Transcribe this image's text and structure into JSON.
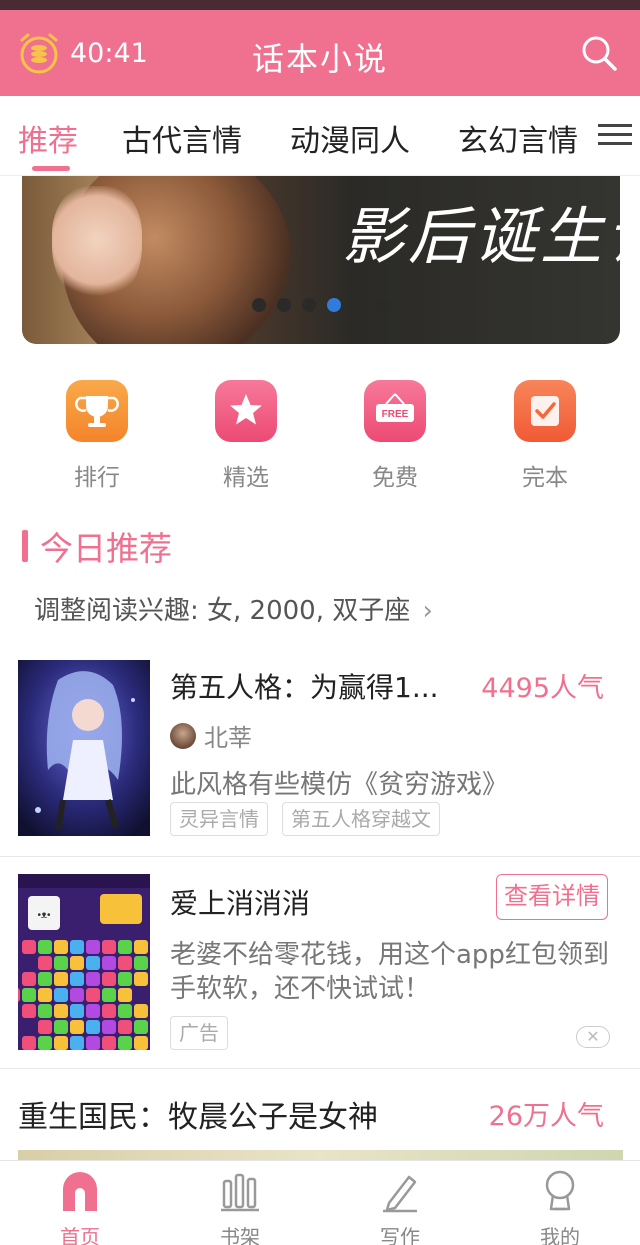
{
  "topbar": {
    "timer": "40:41",
    "title": "话本小说",
    "timer_icon": "alarm-clock-coins-icon",
    "search_icon": "search-icon"
  },
  "tabs": [
    {
      "label": "推荐",
      "active": true
    },
    {
      "label": "古代言情",
      "active": false
    },
    {
      "label": "动漫同人",
      "active": false
    },
    {
      "label": "玄幻言情",
      "active": false
    }
  ],
  "banner": {
    "title": "影后诞生记",
    "slide_count": 6,
    "active_slide": 4
  },
  "quick_links": [
    {
      "label": "排行",
      "icon": "trophy-icon",
      "color": "#f7952f"
    },
    {
      "label": "精选",
      "icon": "star-icon",
      "color": "#f0587e"
    },
    {
      "label": "免费",
      "icon": "free-sign-icon",
      "color": "#f0587e"
    },
    {
      "label": "完本",
      "icon": "checkmark-icon",
      "color": "#f4683a"
    }
  ],
  "section": {
    "title": "今日推荐",
    "interest": "调整阅读兴趣: 女, 2000, 双子座"
  },
  "books": [
    {
      "title": "第五人格：为赢得1...",
      "popularity": "4495人气",
      "author": "北莘",
      "desc": "此风格有些模仿《贫穷游戏》",
      "tags": [
        "灵异言情",
        "第五人格穿越文"
      ]
    }
  ],
  "ad": {
    "title": "爱上消消消",
    "button": "查看详情",
    "desc": "老婆不给零花钱，用这个app红包领到手软软，还不快试试！",
    "tag": "广告",
    "close": "✕"
  },
  "next_book": {
    "title": "重生国民：牧晨公子是女神",
    "popularity": "26万人气"
  },
  "bottom_nav": [
    {
      "label": "首页",
      "icon": "home-icon",
      "active": true
    },
    {
      "label": "书架",
      "icon": "bookshelf-icon",
      "active": false
    },
    {
      "label": "写作",
      "icon": "pencil-icon",
      "active": false
    },
    {
      "label": "我的",
      "icon": "profile-icon",
      "active": false
    }
  ],
  "colors": {
    "accent": "#f0708f",
    "status_bar": "#4a2a33"
  }
}
